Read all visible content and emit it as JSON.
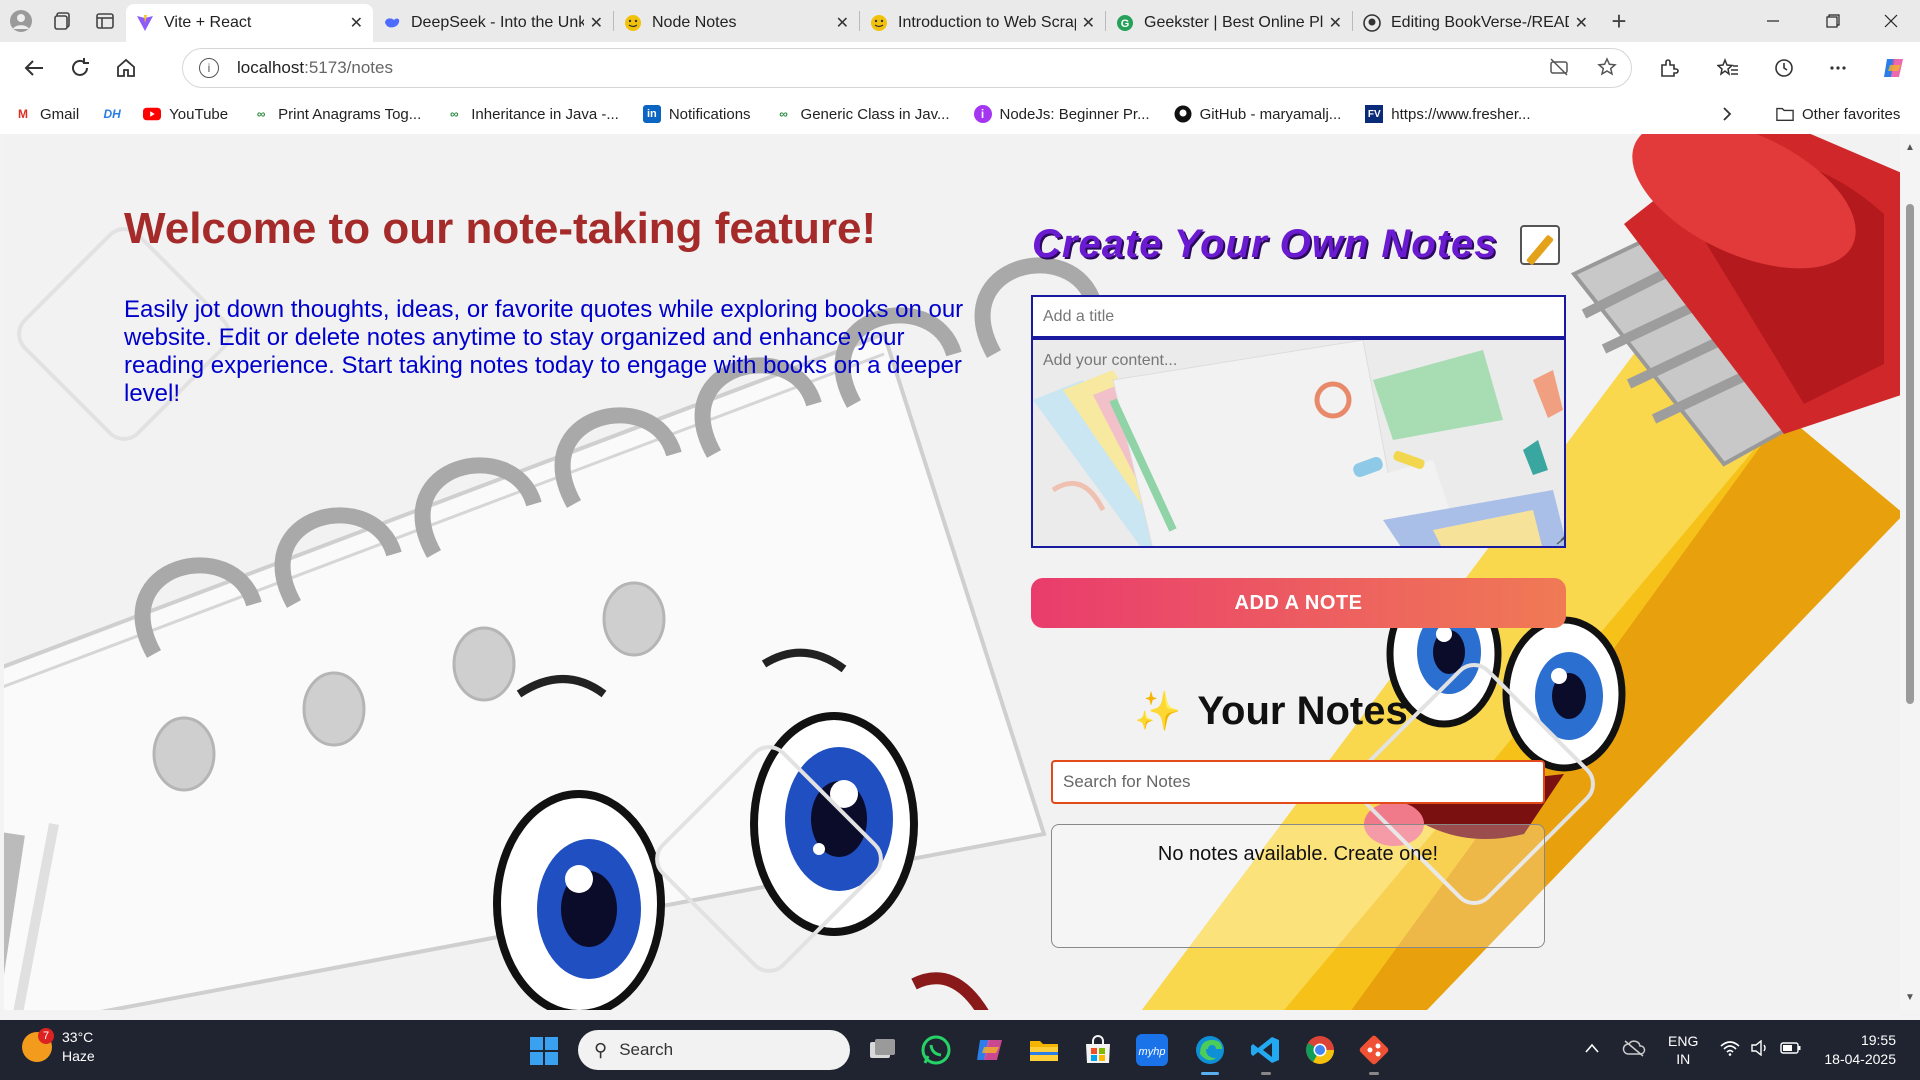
{
  "browser": {
    "tabs": [
      {
        "title": "Vite + React",
        "favicon_color": "#8e5cf7",
        "active": true
      },
      {
        "title": "DeepSeek - Into the Unkn",
        "favicon_color": "#4d6bfe",
        "active": false
      },
      {
        "title": "Node Notes",
        "favicon_color": "#f2c20a",
        "active": false
      },
      {
        "title": "Introduction to Web Scrap",
        "favicon_color": "#f2c20a",
        "active": false
      },
      {
        "title": "Geekster | Best Online Pla",
        "favicon_color": "#27a05a",
        "active": false
      },
      {
        "title": "Editing BookVerse-/READI",
        "favicon_color": "#333333",
        "active": false
      }
    ],
    "new_tab_label": "+",
    "url_host": "localhost",
    "url_path": ":5173/notes",
    "bookmarks": [
      {
        "label": "Gmail",
        "icon": "gmail-icon",
        "color": "#d93025",
        "glyph": "M"
      },
      {
        "label": "",
        "icon": "dh-icon",
        "color": "#2a7de1",
        "glyph": "DH"
      },
      {
        "label": "YouTube",
        "icon": "youtube-icon",
        "color": "#ff0000",
        "glyph": "▶"
      },
      {
        "label": "Print Anagrams Tog...",
        "icon": "gfg-icon",
        "color": "#2f8d46",
        "glyph": "∞"
      },
      {
        "label": "Inheritance in Java -...",
        "icon": "gfg-icon",
        "color": "#2f8d46",
        "glyph": "∞"
      },
      {
        "label": "Notifications",
        "icon": "linkedin-icon",
        "color": "#0a66c2",
        "glyph": "in"
      },
      {
        "label": "Generic Class in Jav...",
        "icon": "gfg-icon",
        "color": "#2f8d46",
        "glyph": "∞"
      },
      {
        "label": "NodeJs: Beginner Pr...",
        "icon": "udemy-icon",
        "color": "#a435f0",
        "glyph": "i"
      },
      {
        "label": "GitHub - maryamalj...",
        "icon": "github-icon",
        "color": "#111111",
        "glyph": "●"
      },
      {
        "label": "https://www.fresher...",
        "icon": "fresher-icon",
        "color": "#0a2a7a",
        "glyph": "FV"
      }
    ],
    "other_favorites": "Other favorites"
  },
  "page": {
    "welcome_title": "Welcome to our note-taking feature!",
    "welcome_text": "Easily jot down thoughts, ideas, or favorite quotes while exploring books on our website. Edit or delete notes anytime to stay organized and enhance your reading experience. Start taking notes today to engage with books on a deeper level!",
    "create_title": "Create Your Own Notes",
    "title_placeholder": "Add a title",
    "content_placeholder": "Add your content...",
    "add_button": "ADD A NOTE",
    "your_notes_title": "Your Notes",
    "search_placeholder": "Search for Notes",
    "empty_message": "No notes available. Create one!"
  },
  "taskbar": {
    "weather_badge": "7",
    "temperature": "33°C",
    "condition": "Haze",
    "search_label": "Search",
    "apps": [
      "task-view-icon",
      "whatsapp-icon",
      "copilot-icon",
      "file-explorer-icon",
      "microsoft-store-icon",
      "myhp-icon",
      "edge-icon",
      "vscode-icon",
      "chrome-icon",
      "git-icon"
    ],
    "lang_line1": "ENG",
    "lang_line2": "IN",
    "time": "19:55",
    "date": "18-04-2025"
  }
}
